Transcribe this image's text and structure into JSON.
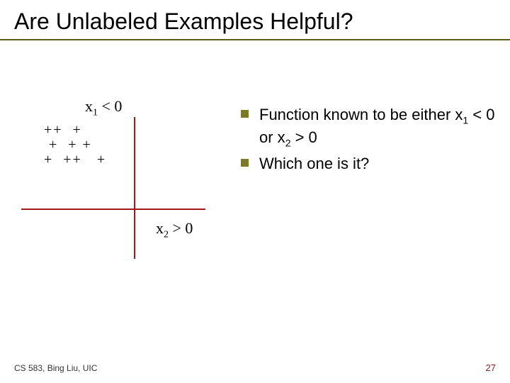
{
  "title": "Are Unlabeled Examples Helpful?",
  "diagram": {
    "x1_var": "x",
    "x1_sub": "1",
    "x1_rest": " < 0",
    "plus_cloud": "++  +\n +  + +\n+  ++   +",
    "x2_var": "x",
    "x2_sub": "2",
    "x2_rest": " > 0"
  },
  "bullets": {
    "b1_pre": "Function known to be either x",
    "b1_s1": "1",
    "b1_mid": " < 0 or x",
    "b1_s2": "2",
    "b1_post": " > 0",
    "b2": "Which one is it?"
  },
  "footer": {
    "left": "CS 583, Bing Liu, UIC",
    "right": "27"
  }
}
